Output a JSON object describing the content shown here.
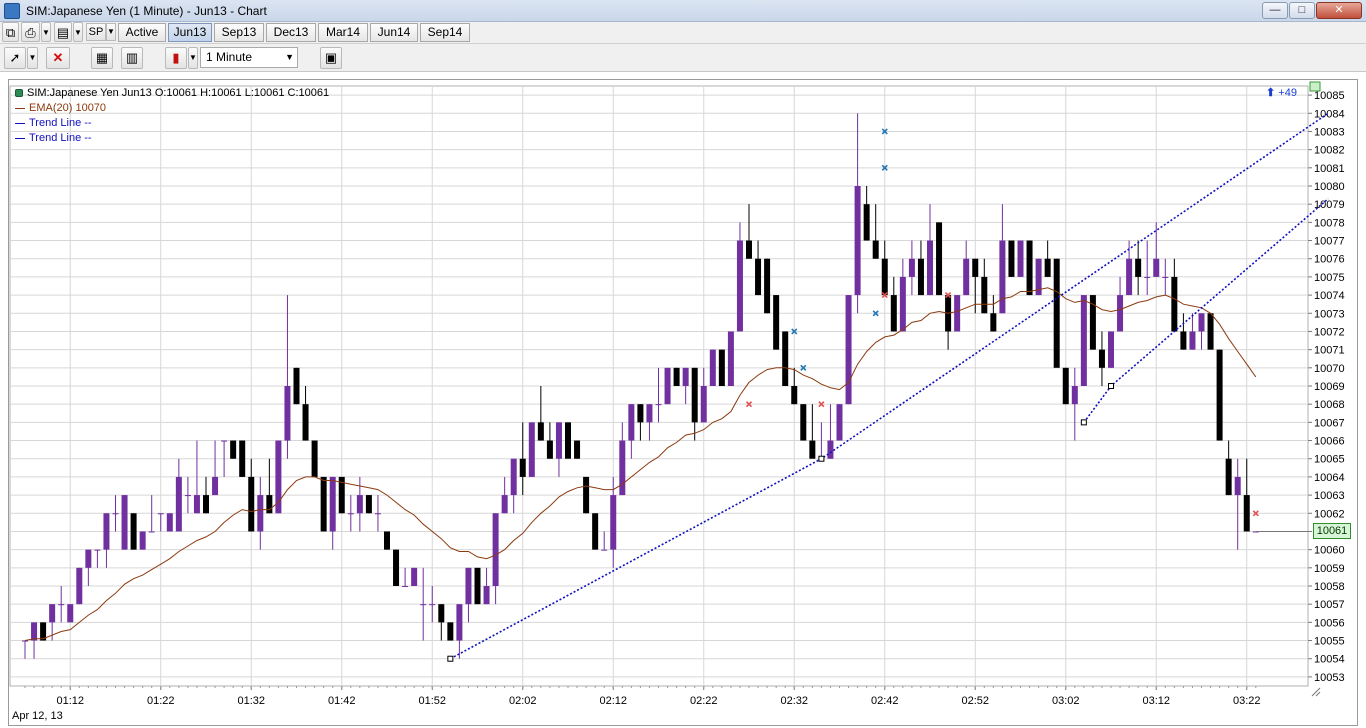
{
  "window": {
    "title": "SIM:Japanese Yen (1 Minute) - Jun13 - Chart",
    "minimize": "—",
    "maximize": "□",
    "close": "✕"
  },
  "toolbar": {
    "instrument_button": "SP",
    "contract_tabs": [
      {
        "label": "Active",
        "selected": false
      },
      {
        "label": "Jun13",
        "selected": true
      },
      {
        "label": "Sep13",
        "selected": false
      },
      {
        "label": "Dec13",
        "selected": false
      },
      {
        "label": "Mar14",
        "selected": false
      },
      {
        "label": "Jun14",
        "selected": false
      },
      {
        "label": "Sep14",
        "selected": false
      }
    ],
    "interval": "1 Minute",
    "interval_arrow": "▼"
  },
  "legend": {
    "quote": "SIM:Japanese Yen Jun13 O:10061 H:10061 L:10061 C:10061",
    "ema": "EMA(20)  10070",
    "trend_line_1": "Trend Line  --",
    "trend_line_2": "Trend Line  --"
  },
  "colors": {
    "up_candle": "#7030a0",
    "down_candle": "#000000",
    "ema": "#8b3a0f",
    "trend_line": "#1010c0",
    "grid": "#d7d7d7",
    "sell_marker": "#e05050",
    "buy_marker": "#1f77b4"
  },
  "plus_count": "+49",
  "date_label": "Apr 12, 13",
  "last_price": "10061",
  "chart_data": {
    "type": "candlestick",
    "y_ticks": [
      10053,
      10054,
      10055,
      10056,
      10057,
      10058,
      10059,
      10060,
      10061,
      10062,
      10063,
      10064,
      10065,
      10066,
      10067,
      10068,
      10069,
      10070,
      10071,
      10072,
      10073,
      10074,
      10075,
      10076,
      10077,
      10078,
      10079,
      10080,
      10081,
      10082,
      10083,
      10084,
      10085
    ],
    "ylim": [
      10052.5,
      10085.5
    ],
    "x_ticks": [
      "01:12",
      "01:22",
      "01:32",
      "01:42",
      "01:52",
      "02:02",
      "02:12",
      "02:22",
      "02:32",
      "02:42",
      "02:52",
      "03:02",
      "03:12",
      "03:22"
    ],
    "last_price": 10061,
    "ema_period": 20,
    "ema_last": 10070,
    "candles": [
      [
        10055,
        10055,
        10054,
        10055
      ],
      [
        10055,
        10056,
        10054,
        10056
      ],
      [
        10056,
        10056,
        10055,
        10055
      ],
      [
        10056,
        10057,
        10055,
        10057
      ],
      [
        10057,
        10058,
        10056,
        10057
      ],
      [
        10056,
        10057,
        10056,
        10057
      ],
      [
        10057,
        10059,
        10057,
        10059
      ],
      [
        10059,
        10060,
        10058,
        10060
      ],
      [
        10060,
        10060,
        10059,
        10060
      ],
      [
        10060,
        10062,
        10059,
        10062
      ],
      [
        10062,
        10063,
        10061,
        10062
      ],
      [
        10060,
        10063,
        10060,
        10063
      ],
      [
        10062,
        10062,
        10060,
        10060
      ],
      [
        10060,
        10061,
        10060,
        10061
      ],
      [
        10061,
        10063,
        10061,
        10061
      ],
      [
        10062,
        10062,
        10061,
        10062
      ],
      [
        10061,
        10062,
        10061,
        10062
      ],
      [
        10061,
        10065,
        10061,
        10064
      ],
      [
        10063,
        10064,
        10062,
        10063
      ],
      [
        10062,
        10066,
        10062,
        10063
      ],
      [
        10063,
        10064,
        10062,
        10062
      ],
      [
        10063,
        10066,
        10063,
        10064
      ],
      [
        10066,
        10066,
        10064,
        10066
      ],
      [
        10066,
        10066,
        10065,
        10065
      ],
      [
        10066,
        10066,
        10064,
        10064
      ],
      [
        10064,
        10065,
        10061,
        10061
      ],
      [
        10061,
        10064,
        10060,
        10063
      ],
      [
        10063,
        10065,
        10062,
        10062
      ],
      [
        10062,
        10066,
        10062,
        10066
      ],
      [
        10066,
        10074,
        10065,
        10069
      ],
      [
        10070,
        10070,
        10068,
        10068
      ],
      [
        10068,
        10069,
        10066,
        10066
      ],
      [
        10066,
        10066,
        10064,
        10064
      ],
      [
        10064,
        10064,
        10061,
        10061
      ],
      [
        10061,
        10064,
        10060,
        10064
      ],
      [
        10064,
        10064,
        10062,
        10062
      ],
      [
        10062,
        10063,
        10061,
        10062
      ],
      [
        10062,
        10064,
        10061,
        10063
      ],
      [
        10063,
        10063,
        10062,
        10062
      ],
      [
        10062,
        10063,
        10061,
        10062
      ],
      [
        10061,
        10061,
        10060,
        10060
      ],
      [
        10060,
        10060,
        10058,
        10058
      ],
      [
        10058,
        10059,
        10058,
        10058
      ],
      [
        10058,
        10059,
        10058,
        10059
      ],
      [
        10057,
        10059,
        10055,
        10057
      ],
      [
        10057,
        10058,
        10056,
        10057
      ],
      [
        10057,
        10057,
        10055,
        10056
      ],
      [
        10056,
        10056,
        10055,
        10055
      ],
      [
        10055,
        10057,
        10054,
        10057
      ],
      [
        10057,
        10059,
        10056,
        10059
      ],
      [
        10059,
        10059,
        10057,
        10057
      ],
      [
        10057,
        10059,
        10057,
        10058
      ],
      [
        10058,
        10062,
        10057,
        10062
      ],
      [
        10062,
        10064,
        10062,
        10063
      ],
      [
        10063,
        10065,
        10062,
        10065
      ],
      [
        10065,
        10067,
        10063,
        10064
      ],
      [
        10064,
        10067,
        10064,
        10067
      ],
      [
        10067,
        10069,
        10066,
        10066
      ],
      [
        10066,
        10067,
        10065,
        10065
      ],
      [
        10065,
        10067,
        10064,
        10067
      ],
      [
        10067,
        10067,
        10066,
        10065
      ],
      [
        10066,
        10066,
        10065,
        10065
      ],
      [
        10064,
        10064,
        10062,
        10062
      ],
      [
        10062,
        10062,
        10060,
        10060
      ],
      [
        10060,
        10061,
        10060,
        10060
      ],
      [
        10060,
        10064,
        10059,
        10063
      ],
      [
        10063,
        10067,
        10063,
        10066
      ],
      [
        10066,
        10068,
        10065,
        10068
      ],
      [
        10068,
        10068,
        10066,
        10067
      ],
      [
        10067,
        10068,
        10066,
        10068
      ],
      [
        10068,
        10070,
        10067,
        10068
      ],
      [
        10068,
        10070,
        10068,
        10070
      ],
      [
        10070,
        10070,
        10069,
        10069
      ],
      [
        10069,
        10070,
        10068,
        10070
      ],
      [
        10070,
        10070,
        10066,
        10067
      ],
      [
        10067,
        10070,
        10067,
        10069
      ],
      [
        10069,
        10071,
        10069,
        10071
      ],
      [
        10071,
        10071,
        10069,
        10069
      ],
      [
        10069,
        10071,
        10069,
        10072
      ],
      [
        10072,
        10078,
        10072,
        10077
      ],
      [
        10077,
        10079,
        10076,
        10076
      ],
      [
        10076,
        10077,
        10074,
        10074
      ],
      [
        10076,
        10076,
        10073,
        10073
      ],
      [
        10074,
        10074,
        10071,
        10071
      ],
      [
        10072,
        10072,
        10069,
        10069
      ],
      [
        10069,
        10070,
        10068,
        10068
      ],
      [
        10068,
        10068,
        10067,
        10066
      ],
      [
        10066,
        10068,
        10066,
        10065
      ],
      [
        10065,
        10067,
        10065,
        10065
      ],
      [
        10065,
        10068,
        10065,
        10066
      ],
      [
        10066,
        10068,
        10066,
        10068
      ],
      [
        10068,
        10074,
        10068,
        10074
      ],
      [
        10074,
        10084,
        10073,
        10080
      ],
      [
        10079,
        10080,
        10077,
        10077
      ],
      [
        10077,
        10079,
        10076,
        10076
      ],
      [
        10076,
        10077,
        10074,
        10074
      ],
      [
        10074,
        10075,
        10072,
        10072
      ],
      [
        10072,
        10076,
        10072,
        10075
      ],
      [
        10075,
        10077,
        10074,
        10076
      ],
      [
        10076,
        10077,
        10074,
        10074
      ],
      [
        10074,
        10079,
        10074,
        10077
      ],
      [
        10078,
        10078,
        10074,
        10074
      ],
      [
        10074,
        10074,
        10071,
        10072
      ],
      [
        10072,
        10074,
        10072,
        10074
      ],
      [
        10074,
        10077,
        10074,
        10076
      ],
      [
        10076,
        10076,
        10073,
        10075
      ],
      [
        10075,
        10076,
        10073,
        10073
      ],
      [
        10073,
        10074,
        10072,
        10072
      ],
      [
        10073,
        10079,
        10073,
        10077
      ],
      [
        10077,
        10077,
        10075,
        10075
      ],
      [
        10075,
        10077,
        10075,
        10077
      ],
      [
        10077,
        10077,
        10074,
        10074
      ],
      [
        10074,
        10076,
        10074,
        10076
      ],
      [
        10076,
        10077,
        10075,
        10075
      ],
      [
        10076,
        10076,
        10071,
        10070
      ],
      [
        10070,
        10070,
        10068,
        10068
      ],
      [
        10068,
        10070,
        10066,
        10069
      ],
      [
        10069,
        10074,
        10069,
        10074
      ],
      [
        10074,
        10074,
        10071,
        10071
      ],
      [
        10071,
        10072,
        10069,
        10070
      ],
      [
        10070,
        10072,
        10070,
        10072
      ],
      [
        10072,
        10075,
        10072,
        10074
      ],
      [
        10074,
        10077,
        10074,
        10076
      ],
      [
        10076,
        10077,
        10074,
        10075
      ],
      [
        10075,
        10077,
        10074,
        10075
      ],
      [
        10075,
        10078,
        10075,
        10076
      ],
      [
        10075,
        10076,
        10074,
        10075
      ],
      [
        10075,
        10076,
        10072,
        10072
      ],
      [
        10072,
        10073,
        10071,
        10071
      ],
      [
        10071,
        10073,
        10071,
        10072
      ],
      [
        10072,
        10073,
        10071,
        10073
      ],
      [
        10073,
        10073,
        10071,
        10071
      ],
      [
        10071,
        10071,
        10066,
        10066
      ],
      [
        10065,
        10066,
        10063,
        10063
      ],
      [
        10063,
        10065,
        10060,
        10064
      ],
      [
        10063,
        10065,
        10061,
        10061
      ],
      [
        10061,
        10061,
        10061,
        10061
      ]
    ],
    "ema": [
      10055.0,
      10055.1,
      10055.1,
      10055.3,
      10055.5,
      10055.6,
      10056.0,
      10056.4,
      10056.7,
      10057.2,
      10057.6,
      10058.1,
      10058.4,
      10058.6,
      10058.9,
      10059.2,
      10059.5,
      10059.9,
      10060.2,
      10060.5,
      10060.7,
      10061.0,
      10061.5,
      10061.9,
      10062.2,
      10062.1,
      10062.2,
      10062.2,
      10062.6,
      10063.3,
      10063.8,
      10064.0,
      10064.0,
      10063.8,
      10063.8,
      10063.7,
      10063.6,
      10063.5,
      10063.4,
      10063.3,
      10063.0,
      10062.6,
      10062.2,
      10061.9,
      10061.4,
      10061.0,
      10060.6,
      10060.1,
      10059.9,
      10059.9,
      10059.6,
      10059.5,
      10059.7,
      10060.0,
      10060.5,
      10060.9,
      10061.5,
      10062.0,
      10062.4,
      10062.9,
      10063.2,
      10063.4,
      10063.5,
      10063.4,
      10063.3,
      10063.3,
      10063.6,
      10064.0,
      10064.4,
      10064.8,
      10065.1,
      10065.6,
      10065.9,
      10066.3,
      10066.4,
      10066.6,
      10067.0,
      10067.2,
      10067.6,
      10068.5,
      10069.2,
      10069.6,
      10069.9,
      10070.0,
      10070.0,
      10069.9,
      10069.6,
      10069.4,
      10069.1,
      10068.9,
      10068.8,
      10069.2,
      10070.2,
      10070.9,
      10071.4,
      10071.7,
      10071.8,
      10072.1,
      10072.5,
      10072.6,
      10073.0,
      10073.1,
      10073.0,
      10073.1,
      10073.3,
      10073.5,
      10073.5,
      10073.5,
      10073.8,
      10073.9,
      10074.2,
      10074.2,
      10074.3,
      10074.4,
      10074.2,
      10073.8,
      10073.6,
      10073.7,
      10073.5,
      10073.2,
      10073.1,
      10073.2,
      10073.4,
      10073.6,
      10073.7,
      10073.9,
      10074.0,
      10073.8,
      10073.5,
      10073.4,
      10073.3,
      10073.0,
      10072.4,
      10071.6,
      10070.9,
      10070.2,
      10069.5
    ],
    "trend_lines": [
      {
        "points": [
          [
            47,
            10054
          ],
          [
            88,
            10065
          ],
          [
            144,
            10084
          ]
        ]
      },
      {
        "points": [
          [
            117,
            10067
          ],
          [
            120,
            10069
          ],
          [
            144,
            10079.3
          ]
        ]
      }
    ],
    "sell_markers": [
      [
        80,
        10068
      ],
      [
        88,
        10068
      ],
      [
        95,
        10074
      ],
      [
        102,
        10074
      ],
      [
        136,
        10062
      ]
    ],
    "buy_markers": [
      [
        85,
        10072
      ],
      [
        86,
        10070
      ],
      [
        94,
        10073
      ],
      [
        95,
        10081
      ],
      [
        95,
        10083
      ]
    ]
  }
}
